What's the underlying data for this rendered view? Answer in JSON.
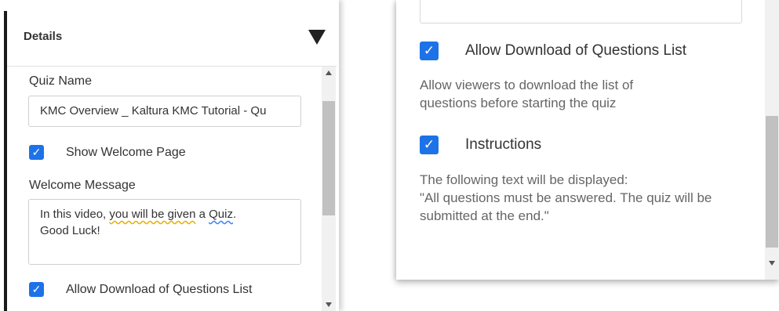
{
  "details": {
    "title": "Details"
  },
  "left": {
    "quiz_name_label": "Quiz Name",
    "quiz_name_value": "KMC Overview _ Kaltura KMC Tutorial - Qu",
    "show_welcome_label": "Show Welcome Page",
    "welcome_message_label": "Welcome Message",
    "welcome_msg": {
      "part1": "In this video, ",
      "part2": "you will be given",
      "part3": " a ",
      "part4": "Quiz",
      "part5": ".",
      "line2": "Good Luck!"
    },
    "allow_download_label": "Allow Download of Questions List"
  },
  "right": {
    "allow_download_label": "Allow Download of Questions List",
    "allow_download_desc": "Allow viewers to download the list of questions before starting the quiz",
    "instructions_label": "Instructions",
    "instructions_desc_line1": "The following text will be displayed:",
    "instructions_desc_line2": "\"All questions must be answered. The quiz will be submitted at the end.\""
  },
  "icons": {
    "checkmark": "✓",
    "collapse": "triangle-down-icon"
  },
  "colors": {
    "checkbox": "#1d72e8",
    "spell_yellow": "#e3b000",
    "spell_blue": "#3b82f6"
  }
}
